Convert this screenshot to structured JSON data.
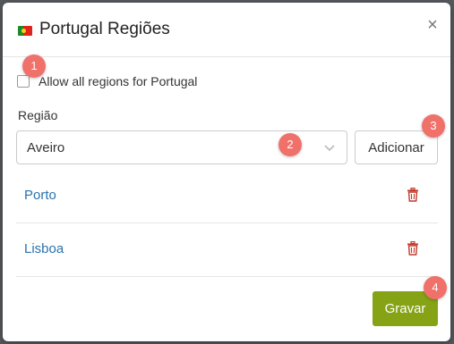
{
  "dialog": {
    "title": "Portugal Regiões",
    "close_label": "×",
    "flag_icon": "portugal-flag-icon"
  },
  "allow_all": {
    "label": "Allow all regions for Portugal",
    "checked": false
  },
  "region_field": {
    "label": "Região",
    "selected_value": "Aveiro"
  },
  "buttons": {
    "add_label": "Adicionar",
    "save_label": "Gravar"
  },
  "regions": [
    {
      "name": "Porto"
    },
    {
      "name": "Lisboa"
    }
  ],
  "badges": [
    "1",
    "2",
    "3",
    "4"
  ],
  "colors": {
    "link": "#2a72ae",
    "delete": "#c0392b",
    "save": "#85a314",
    "badge": "#f0706a"
  }
}
